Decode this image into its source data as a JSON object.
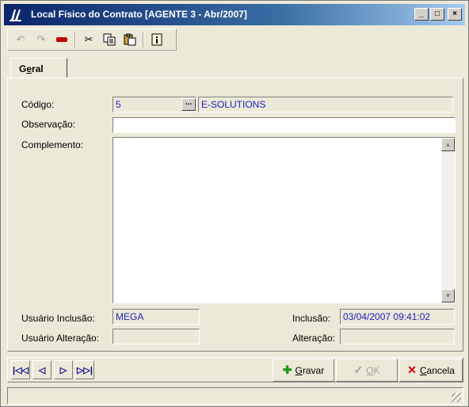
{
  "window": {
    "title": "Local Físico do Contrato [AGENTE 3 - Abr/2007]",
    "minimize_icon": "minimize-icon",
    "maximize_icon": "maximize-icon",
    "close_icon": "close-icon"
  },
  "toolbar": {
    "items": [
      "undo-icon",
      "redo-icon",
      "remove-icon",
      "cut-icon",
      "copy-icon",
      "paste-icon",
      "info-icon"
    ]
  },
  "tabs": [
    {
      "label_pre": "G",
      "label_underline": "e",
      "label_post": "ral"
    }
  ],
  "form": {
    "codigo_label": "Código:",
    "codigo_value": "5",
    "codigo_desc": "E-SOLUTIONS",
    "observacao_label": "Observação:",
    "observacao_value": "",
    "complemento_label": "Complemento:",
    "complemento_value": "",
    "usuario_inclusao_label": "Usuário Inclusão:",
    "usuario_inclusao_value": "MEGA",
    "usuario_alteracao_label": "Usuário Alteração:",
    "usuario_alteracao_value": "",
    "inclusao_label": "Inclusão:",
    "inclusao_value": "03/04/2007 09:41:02",
    "alteracao_label": "Alteração:",
    "alteracao_value": ""
  },
  "nav": {
    "first": "first-record-icon",
    "prev": "prev-record-icon",
    "next": "next-record-icon",
    "last": "last-record-icon"
  },
  "actions": {
    "gravar_u": "G",
    "gravar_rest": "ravar",
    "ok_u": "O",
    "ok_rest": "K",
    "cancela_u": "C",
    "cancela_rest": "ancela"
  },
  "colors": {
    "window_bg": "#ece9d8",
    "title_bar": "#0a246a",
    "readonly_text": "#2020c0",
    "gravar_icon": "#1a9a1a",
    "cancela_icon": "#d00000"
  }
}
